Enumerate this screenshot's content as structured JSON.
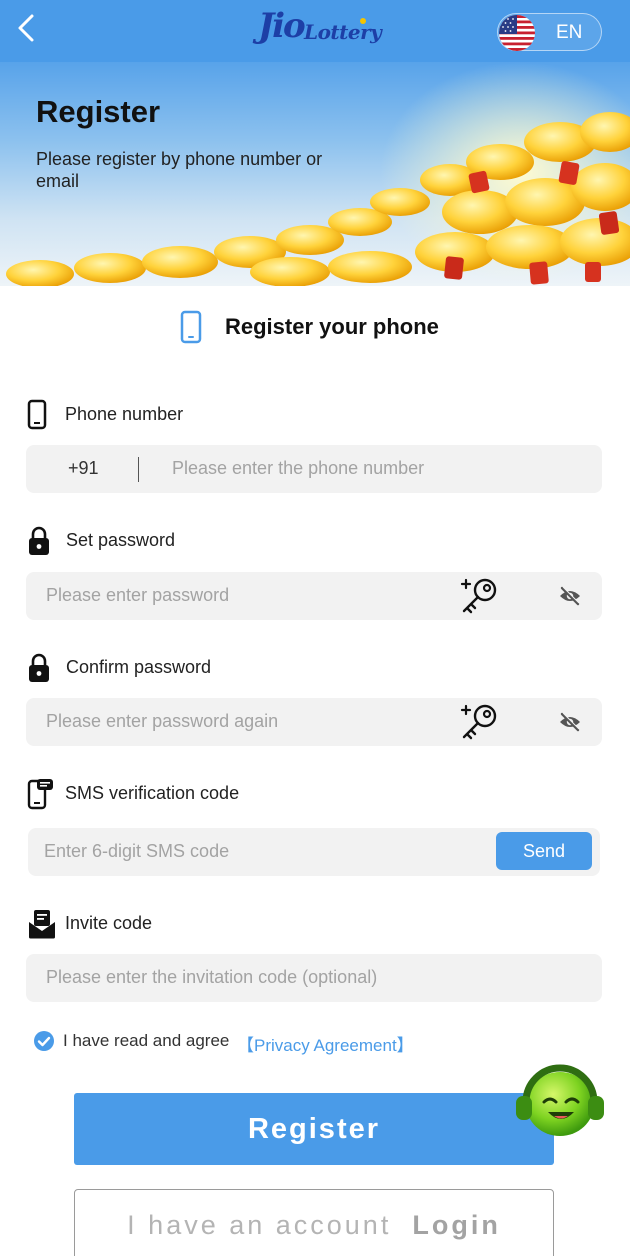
{
  "header": {
    "logo_main": "Jio",
    "logo_sub": "Lottery",
    "language": "EN",
    "colors": {
      "bar": "#4a9be8",
      "logo": "#1d3fa6"
    }
  },
  "banner": {
    "title": "Register",
    "subtitle": "Please register by phone number or email"
  },
  "section": {
    "title": "Register your phone"
  },
  "form": {
    "phone": {
      "label": "Phone number",
      "country_code": "+91",
      "placeholder": "Please enter the phone number"
    },
    "password": {
      "label": "Set password",
      "placeholder": "Please enter password"
    },
    "confirm": {
      "label": "Confirm password",
      "placeholder": "Please enter password again"
    },
    "sms": {
      "label": "SMS verification code",
      "placeholder": "Enter 6-digit SMS code",
      "send_label": "Send"
    },
    "invite": {
      "label": "Invite code",
      "placeholder": "Please enter the invitation code (optional)"
    }
  },
  "agreement": {
    "text": "I have read and agree",
    "link": "【Privacy Agreement】",
    "checked": true
  },
  "actions": {
    "register_label": "Register",
    "login_prefix": "I have an account",
    "login_label": "Login"
  },
  "icons": [
    "back-icon",
    "us-flag-icon",
    "phone-icon",
    "lock-icon",
    "key-icon",
    "eye-off-icon",
    "sms-phone-icon",
    "envelope-icon",
    "check-icon",
    "support-mascot-icon"
  ]
}
